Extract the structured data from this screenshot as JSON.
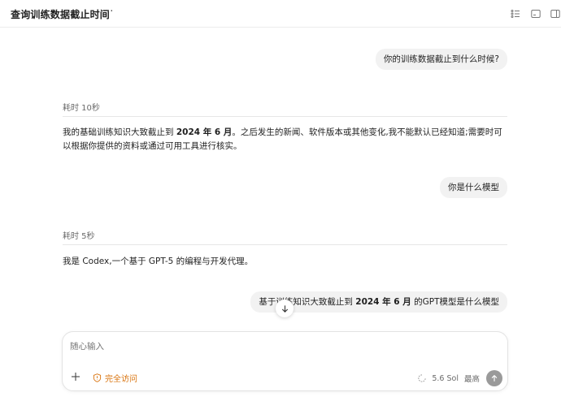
{
  "header": {
    "title": "查询训练数据截止时间",
    "more": "···",
    "icons": [
      "checklist-icon",
      "terminal-icon",
      "panel-icon"
    ]
  },
  "conversation": [
    {
      "role": "user",
      "text": "你的训练数据截止到什么时候?"
    },
    {
      "role": "assistant",
      "elapsed": "耗时 10秒",
      "line1_pre": "我的基础训练知识大致截止到 ",
      "line1_bold": "2024 年 6 月",
      "line1_post": "。之后发生的新闻、软件版本或其他变化,我不能默认已经知道;需要时可",
      "line2": "以根据你提供的资料或通过可用工具进行核实。"
    },
    {
      "role": "user",
      "text": "你是什么模型"
    },
    {
      "role": "assistant",
      "elapsed": "耗时 5秒",
      "text": "我是 Codex,一个基于 GPT-5 的编程与开发代理。"
    },
    {
      "role": "user",
      "pre": "基于训练知识大致截止到 ",
      "bold": "2024 年 6 月",
      "post": " 的GPT模型是什么模型"
    }
  ],
  "composer": {
    "placeholder": "随心输入",
    "access_label": "完全访问",
    "model_label": "5.6 Sol",
    "effort_label": "最高"
  },
  "colors": {
    "accent_orange": "#d9730d",
    "bubble_bg": "#f2f2f2",
    "send_disabled": "#9a9a9a"
  }
}
